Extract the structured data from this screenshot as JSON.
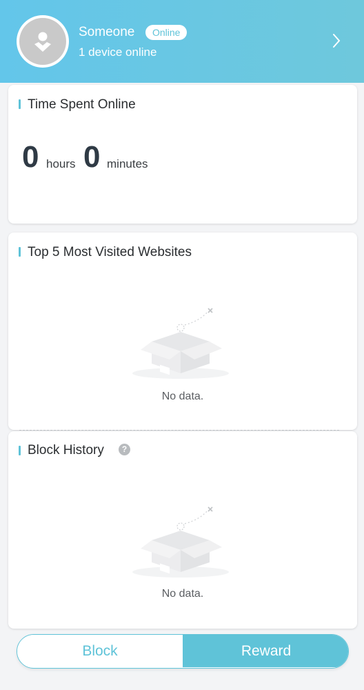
{
  "profile": {
    "name": "Someone",
    "status": "Online",
    "device_line": "1 device online"
  },
  "time_card": {
    "title": "Time Spent Online",
    "hours_value": "0",
    "hours_unit": "hours",
    "minutes_value": "0",
    "minutes_unit": "minutes"
  },
  "sites_card": {
    "title": "Top 5 Most Visited Websites",
    "empty_text": "No data."
  },
  "block_card": {
    "title": "Block History",
    "help_glyph": "?",
    "empty_text": "No data."
  },
  "toggle": {
    "block_label": "Block",
    "reward_label": "Reward",
    "selected": "Reward"
  },
  "colors": {
    "accent": "#5fc3d8",
    "header_start": "#63c6ea",
    "header_end": "#6ec8dc",
    "avatar_gray": "#c9c9c9"
  },
  "icons": [
    "avatar-person-icon",
    "chevron-right-icon",
    "help-icon",
    "empty-box-icon"
  ]
}
